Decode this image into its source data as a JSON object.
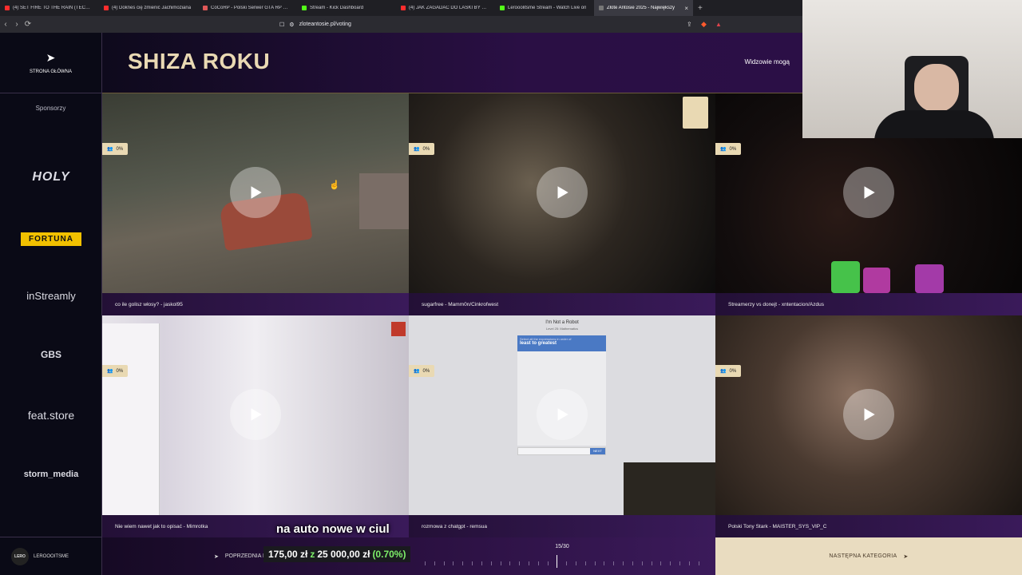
{
  "browser": {
    "tabs": [
      {
        "label": "(4) SET FIRE TO THE RAIN (TECHNO)",
        "color": "#ff2d2d"
      },
      {
        "label": "(4) Doknes cię zmienić Jachimoziana",
        "color": "#ff2d2d"
      },
      {
        "label": "CoCoRP - Polski Serwer GTA RP Whi",
        "color": "#e05858"
      },
      {
        "label": "Stream - Kick Dashboard",
        "color": "#53fc18"
      },
      {
        "label": "(4) JAK ZAGADAĆ DO LASKI BY ZGR",
        "color": "#ff2d2d"
      },
      {
        "label": "Lerooolitsme Stream - Watch Live on",
        "color": "#53fc18"
      },
      {
        "label": "Złote Antosie 2025 - Największy",
        "color": "#777777",
        "active": true
      }
    ],
    "new_tab": "+",
    "url": "zloteantosie.pl/voting"
  },
  "sidebar": {
    "home_label": "STRONA GŁÓWNA",
    "sponsors_label": "Sponsorzy",
    "sponsors": [
      "HOLY",
      "FORTUNA",
      "inStreamly",
      "GBS",
      "feat.store",
      "storm_media"
    ],
    "user": {
      "avatar_text": "LERO",
      "name": "LEROOOITSME"
    }
  },
  "header": {
    "title": "SHIZA ROKU",
    "viewers_label": "Widzowie mogą"
  },
  "cards": [
    {
      "caption": "co ile golisz włosy? - jaskol95",
      "percent": "0%"
    },
    {
      "caption": "sugarfree - Mamm0n/Cinkrofwest",
      "percent": "0%"
    },
    {
      "caption": "Streamerzy vs donejt - xntentacion/Azdus",
      "percent": "0%"
    },
    {
      "caption": "Nie wiem nawet jak to opisać - Mimrotka",
      "percent": "0%"
    },
    {
      "caption": "rozmowa z chatgpt - remsua",
      "percent": "0%"
    },
    {
      "caption": "Polski Tony Stark - MAISTER_SYS_VIP_C",
      "percent": "0%"
    }
  ],
  "captcha": {
    "title": "I'm Not a Robot",
    "subtitle": "Level 25: Mathematics",
    "prompt_small": "Select all the expressions in order of",
    "prompt": "least to greatest",
    "submit": "NEXT"
  },
  "overlay": {
    "subtitle": "na auto nowe w ciul",
    "donation": {
      "amount": "175,00 zł",
      "z": "z",
      "goal": "25 000,00 zł",
      "percent": "(0.70%)"
    }
  },
  "footer": {
    "prev_label": "POPRZEDNIA KATEGORIA",
    "counter": "15/30",
    "current_index": 15,
    "total": 30,
    "next_label": "NASTĘPNA KATEGORIA"
  }
}
